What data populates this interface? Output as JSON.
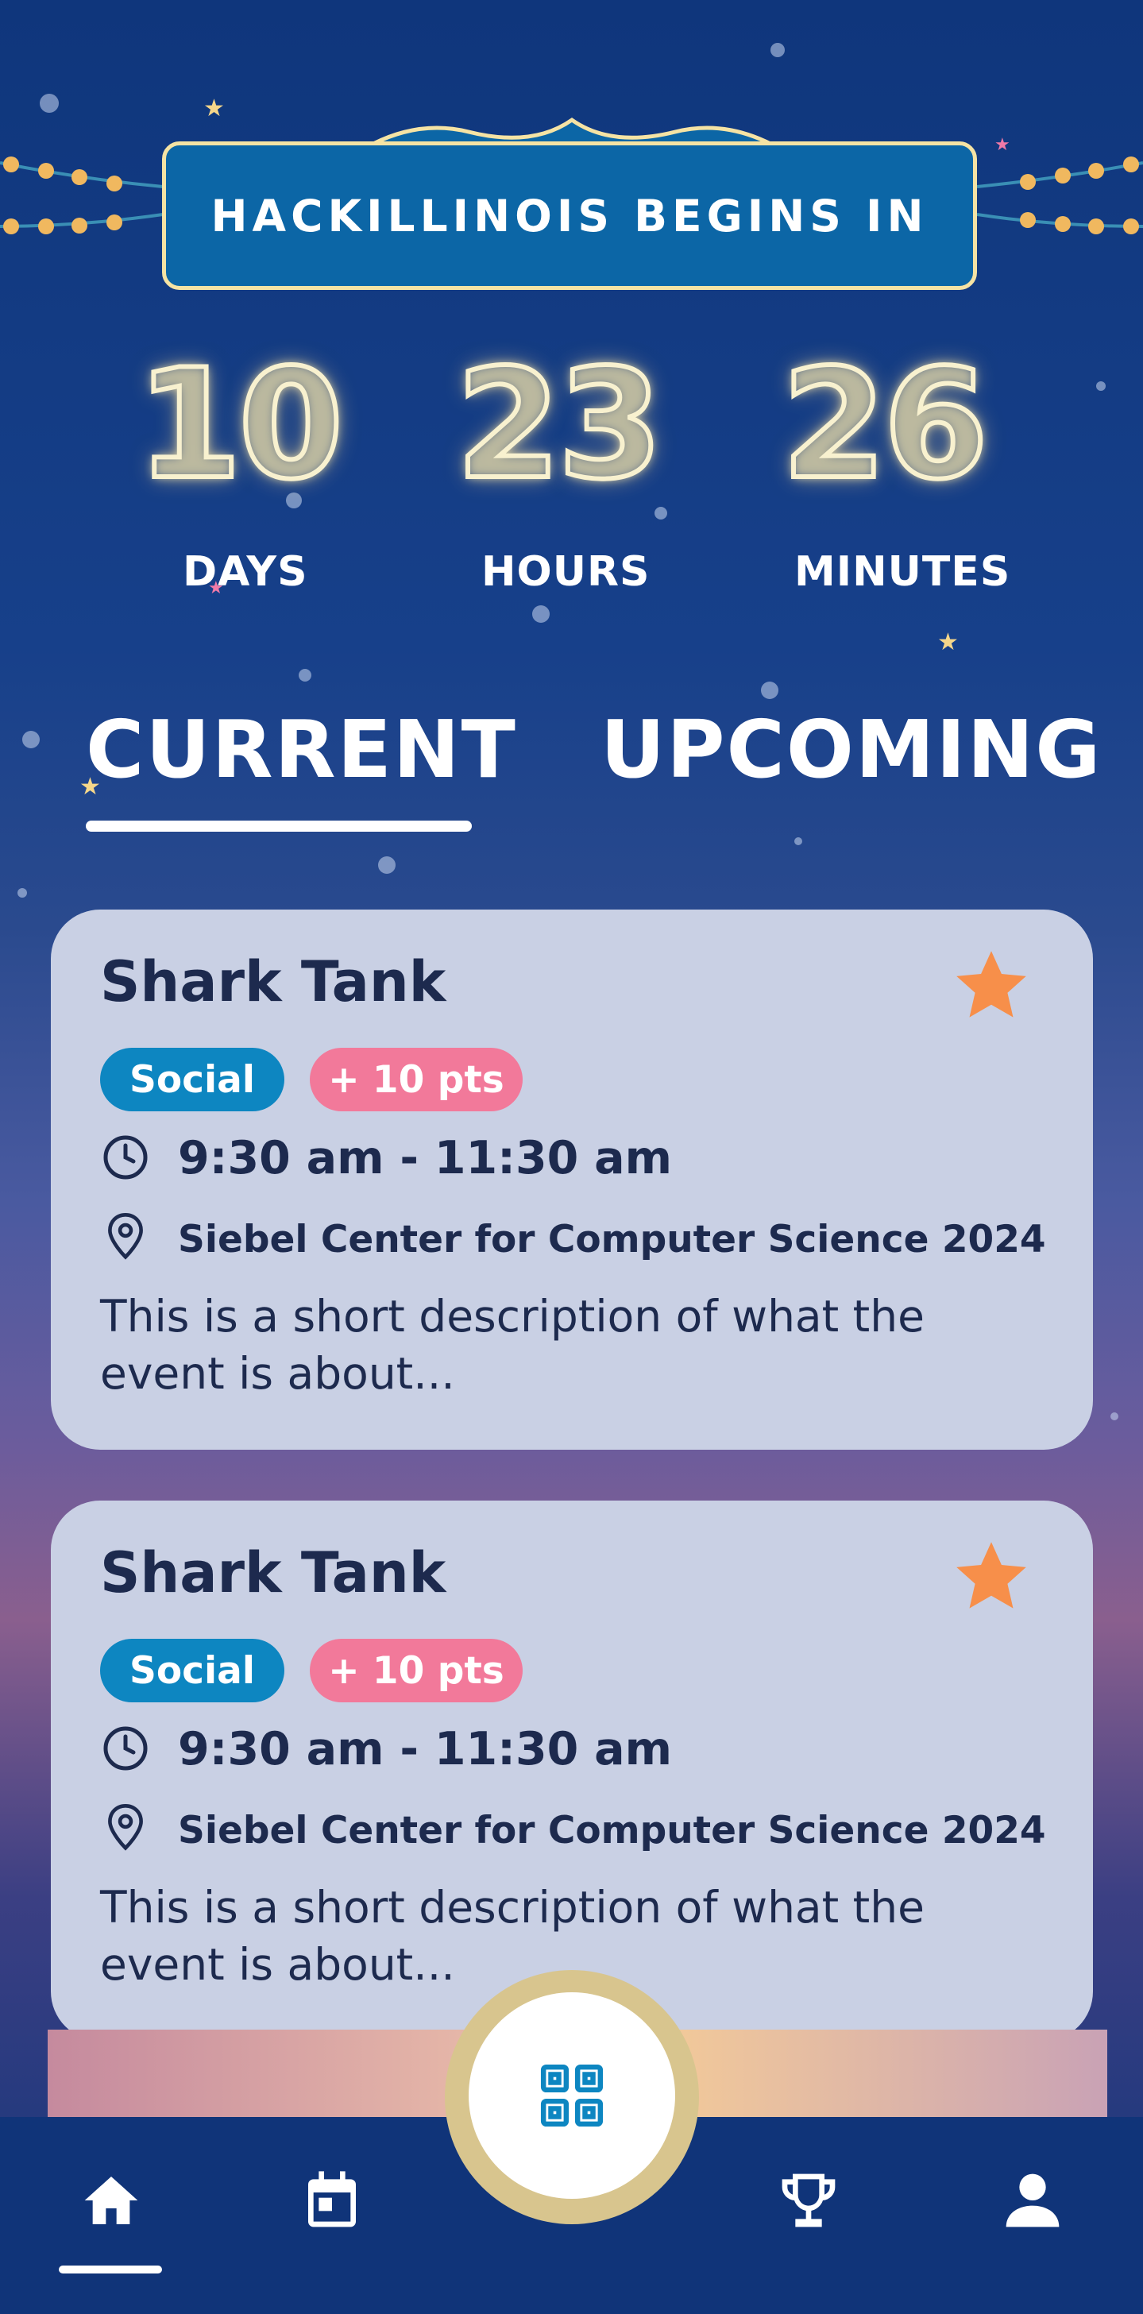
{
  "header": {
    "banner_title": "HACKILLINOIS BEGINS IN"
  },
  "countdown": {
    "days": "10",
    "hours": "23",
    "minutes": "26",
    "days_label": "DAYS",
    "hours_label": "HOURS",
    "minutes_label": "MINUTES"
  },
  "tabs": {
    "current": "CURRENT",
    "upcoming": "UPCOMING",
    "active": "current"
  },
  "events": [
    {
      "title": "Shark Tank",
      "category": "Social",
      "points": "+ 10 pts",
      "time": "9:30 am - 11:30 am",
      "location": "Siebel Center for Computer Science 2024",
      "description": "This is a short description of what the event is about..."
    },
    {
      "title": "Shark Tank",
      "category": "Social",
      "points": "+ 10 pts",
      "time": "9:30 am - 11:30 am",
      "location": "Siebel Center for Computer Science 2024",
      "description": "This is a short description of what the event is about..."
    }
  ],
  "nav": {
    "items": [
      "home-icon",
      "calendar-icon",
      "qr-code-icon",
      "trophy-icon",
      "profile-icon"
    ],
    "active": "home"
  },
  "colors": {
    "background": "#0f367c",
    "card": "#c9d0e4",
    "social_pill": "#0d86c1",
    "points_pill": "#f2799a",
    "favorite_star": "#f78f4a",
    "text_dark": "#1d2a4e"
  }
}
